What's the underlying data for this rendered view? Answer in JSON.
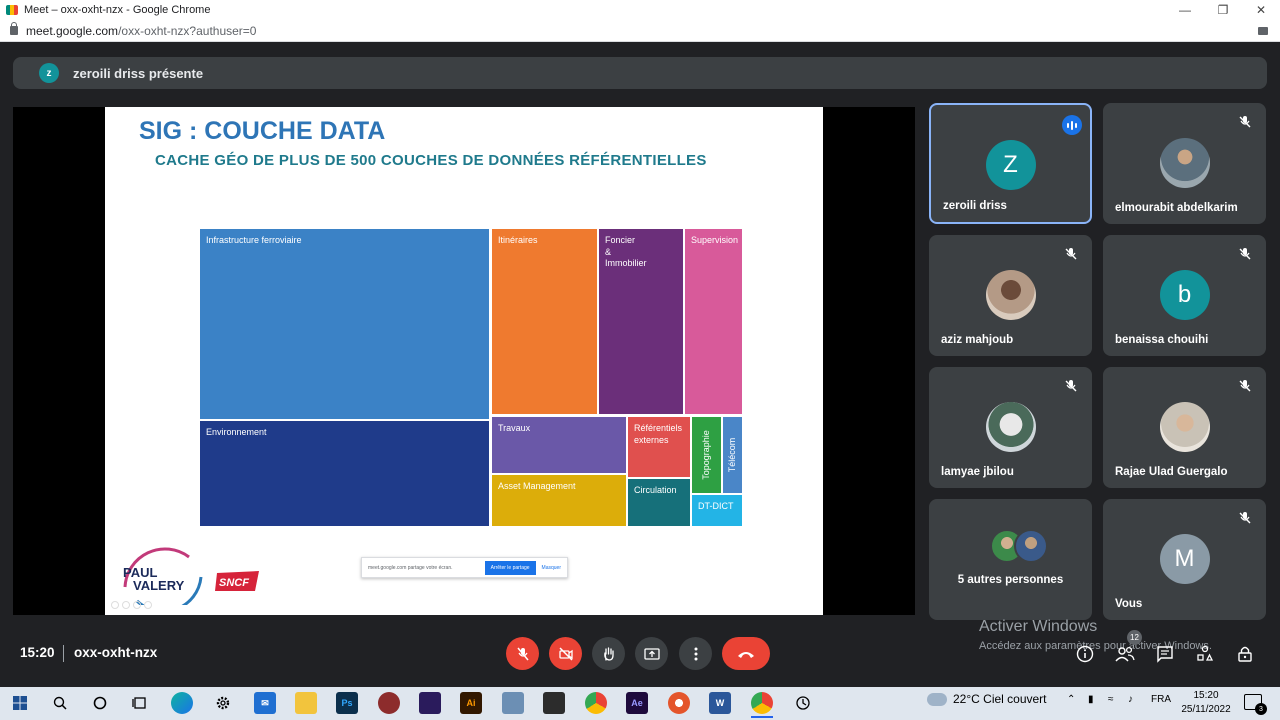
{
  "browser": {
    "window_title": "Meet – oxx-oxht-nzx - Google Chrome",
    "url_host": "meet.google.com",
    "url_path": "/oxx-oxht-nzx?authuser=0"
  },
  "meet": {
    "presenter_initial": "z",
    "presenter_banner": "zeroili driss présente",
    "time": "15:20",
    "meeting_code": "oxx-oxht-nzx",
    "people_count": "12"
  },
  "slide": {
    "title": "SIG : COUCHE DATA",
    "subtitle": "CACHE GÉO DE PLUS DE 500 COUCHES DE DONNÉES RÉFÉRENTIELLES",
    "share_toast": {
      "text": "meet.google.com partage votre écran.",
      "stop": "Arrêter le partage",
      "hide": "Masquer"
    }
  },
  "chart_data": {
    "type": "treemap",
    "title": "",
    "labels": [
      "Infrastructure ferroviaire",
      "Environnement",
      "Itinéraires",
      "Foncier\n&\nImmobilier",
      "Supervision",
      "Travaux",
      "Asset Management",
      "Référentiels\nexternes",
      "Circulation",
      "Topographie",
      "Télécom",
      "DT-DICT"
    ],
    "colors": [
      "#3b82c6",
      "#1f3b8a",
      "#ef7a2f",
      "#6b2f7a",
      "#d85a9a",
      "#6a58a8",
      "#dcad0a",
      "#e0504e",
      "#16707a",
      "#2ea043",
      "#4a86c8",
      "#23b4e6"
    ]
  },
  "participants": [
    {
      "name": "zeroili driss",
      "initial": "Z",
      "color": "#12939a",
      "speaking": true
    },
    {
      "name": "elmourabit abdelkarim",
      "photo": true,
      "muted": true
    },
    {
      "name": "aziz mahjoub",
      "photo": true,
      "muted": true
    },
    {
      "name": "benaissa chouihi",
      "initial": "b",
      "color": "#12939a",
      "muted": true
    },
    {
      "name": "lamyae jbilou",
      "photo": true,
      "muted": true
    },
    {
      "name": "Rajae Ulad Guergalo",
      "photo": true,
      "muted": true
    },
    {
      "name": "5 autres personnes"
    },
    {
      "name": "Vous",
      "initial": "M",
      "color": "#8a9aa6",
      "muted": true
    }
  ],
  "windows_watermark": {
    "title": "Activer Windows",
    "subtitle": "Accédez aux paramètres pour activer Windows."
  },
  "taskbar": {
    "weather": "22°C  Ciel couvert",
    "lang": "FRA",
    "time": "15:20",
    "date": "25/11/2022",
    "notifications": "3"
  }
}
